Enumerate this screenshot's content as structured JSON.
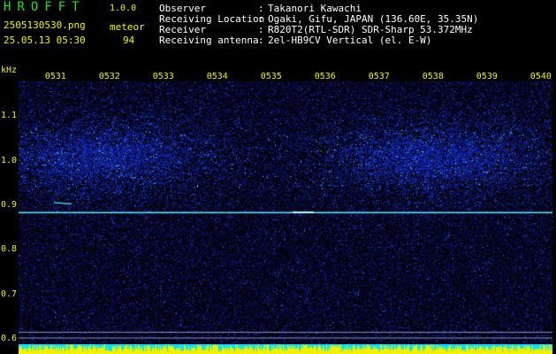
{
  "header": {
    "app_title": "HROFFT",
    "app_version": "1.0.0",
    "file_name": "2505130530.png",
    "date_time": "25.05.13 05:30",
    "meteor_label": "meteor",
    "meteor_count": "94"
  },
  "station_info": [
    {
      "key": "Observer",
      "value": "Takanori Kawachi"
    },
    {
      "key": "Receiving Location",
      "value": "Ogaki, Gifu, JAPAN (136.60E, 35.35N)"
    },
    {
      "key": "Receiver",
      "value": "R820T2(RTL-SDR) SDR-Sharp 53.372MHz"
    },
    {
      "key": "Receiving antenna",
      "value": "2el-HB9CV Vertical (el. E-W)"
    }
  ],
  "separator": ":",
  "chart_data": {
    "type": "heatmap",
    "title": "",
    "ylabel": "kHz",
    "xlabel": "",
    "x_ticks": [
      "0531",
      "0532",
      "0533",
      "0534",
      "0535",
      "0536",
      "0537",
      "0538",
      "0539",
      "0540"
    ],
    "y_ticks": [
      "1.1",
      "1.0",
      "0.9",
      "0.8",
      "0.7",
      "0.6"
    ],
    "y_tick_values": [
      1.1,
      1.0,
      0.9,
      0.8,
      0.7,
      0.6
    ],
    "ylim": [
      0.59,
      1.18
    ],
    "xlim_minutes": [
      30.3,
      40.2
    ],
    "carrier_frequency_khz": 0.887,
    "reference_lines_khz": [
      0.618,
      0.605
    ]
  },
  "colors": {
    "background": "#000000",
    "text_yellow": "#f2f200",
    "title_green": "#20e020",
    "noise_dark": "#07105a",
    "noise_bright": "#3050ff",
    "echo_cyan": "#40f0ff",
    "carrier": "#60e8ff",
    "volume_yellow": "#f0f000",
    "volume_cyan": "#00e0ff"
  }
}
